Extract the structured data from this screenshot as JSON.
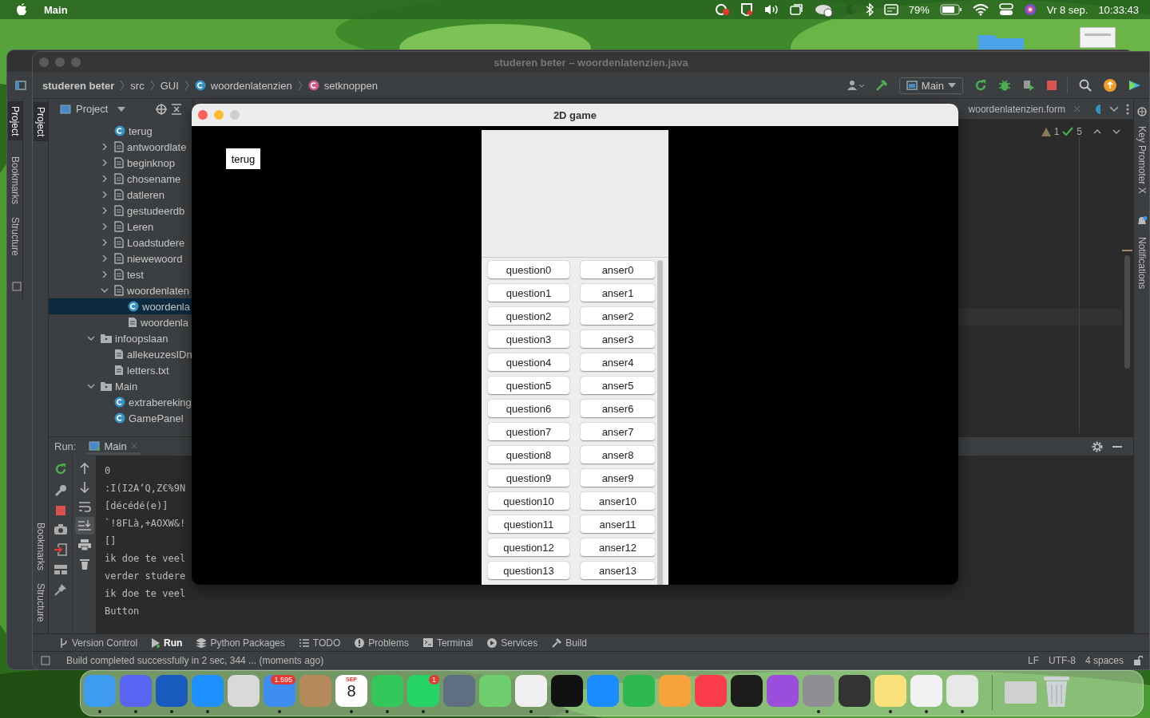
{
  "menu_bar": {
    "app_name": "Main",
    "battery": "79%",
    "date": "Vr 8 sep.",
    "time": "10:33:43"
  },
  "back_window": {
    "stripe_top": [
      "Project"
    ],
    "stripe_bottom": [
      "Bookmarks",
      "Structure"
    ]
  },
  "ide": {
    "title": "studeren beter – woordenlatenzien.java",
    "breadcrumbs": [
      {
        "label": "studeren beter",
        "kind": "project"
      },
      {
        "label": "src",
        "kind": "folder"
      },
      {
        "label": "GUI",
        "kind": "folder"
      },
      {
        "label": "woordenlatenzien",
        "kind": "class"
      },
      {
        "label": "setknoppen",
        "kind": "method"
      }
    ],
    "run_config": "Main",
    "stripe_top": [
      "Project"
    ],
    "stripe_bottom": [
      "Bookmarks",
      "Structure"
    ],
    "project_panel": {
      "title": "Project",
      "tree": [
        {
          "children": [
            {
              "label": "terug",
              "kind": "class",
              "selected": false
            },
            {
              "label": "antwoordlate",
              "kind": "form",
              "expanded": false,
              "selected": false
            },
            {
              "label": "beginknop",
              "kind": "form",
              "expanded": false,
              "selected": false
            },
            {
              "label": "chosename",
              "kind": "form",
              "expanded": false,
              "selected": false
            },
            {
              "label": "datleren",
              "kind": "form",
              "expanded": false,
              "selected": false
            },
            {
              "label": "gestudeerdb",
              "kind": "form",
              "expanded": false,
              "selected": false
            },
            {
              "label": "Leren",
              "kind": "form",
              "expanded": false,
              "selected": false
            },
            {
              "label": "Loadstudere",
              "kind": "form",
              "expanded": false,
              "selected": false
            },
            {
              "label": "niewewoord",
              "kind": "form",
              "expanded": false,
              "selected": false
            },
            {
              "label": "test",
              "kind": "form",
              "expanded": false,
              "selected": false
            },
            {
              "label": "woordenlaten",
              "kind": "form",
              "expanded": true,
              "selected": false,
              "children": [
                {
                  "label": "woordenla",
                  "kind": "class",
                  "selected": true
                },
                {
                  "label": "woordenla",
                  "kind": "file",
                  "selected": false
                }
              ]
            }
          ]
        },
        {
          "label": "infoopslaan",
          "kind": "folder",
          "expanded": true,
          "selected": false,
          "children": [
            {
              "label": "allekeuzesIDn",
              "kind": "file",
              "selected": false
            },
            {
              "label": "letters.txt",
              "kind": "file",
              "selected": false
            }
          ]
        },
        {
          "label": "Main",
          "kind": "folder",
          "expanded": true,
          "selected": false,
          "children": [
            {
              "label": "extrabereking",
              "kind": "class",
              "selected": false
            },
            {
              "label": "GamePanel",
              "kind": "class",
              "selected": false
            }
          ]
        }
      ]
    },
    "editor": {
      "tab": "woordenlatenzien.form",
      "warnings": "1",
      "checks": "5"
    },
    "right_stripe": [
      "Key Promoter X",
      "Notifications"
    ],
    "run_panel": {
      "label": "Run:",
      "tab": "Main",
      "console": [
        "0",
        ":I(I2A‘Q,Z€%9N",
        "[décédé(e)]",
        "`!8FLà,+AOXW&!",
        "[]",
        "ik doe te veel",
        "verder studere",
        "ik doe te veel",
        "Button"
      ]
    },
    "tool_tabs": [
      {
        "label": "Version Control",
        "kind": "vcs",
        "selected": false
      },
      {
        "label": "Run",
        "kind": "run",
        "selected": true
      },
      {
        "label": "Python Packages",
        "kind": "packages",
        "selected": false
      },
      {
        "label": "TODO",
        "kind": "todo",
        "selected": false
      },
      {
        "label": "Problems",
        "kind": "problems",
        "selected": false
      },
      {
        "label": "Terminal",
        "kind": "terminal",
        "selected": false
      },
      {
        "label": "Services",
        "kind": "services",
        "selected": false
      },
      {
        "label": "Build",
        "kind": "build",
        "selected": false
      }
    ],
    "status_bar": {
      "message": "Build completed successfully in 2 sec, 344 ... (moments ago)",
      "line_ending": "LF",
      "encoding": "UTF-8",
      "indent": "4 spaces"
    }
  },
  "game_window": {
    "title": "2D game",
    "back_button": "terug",
    "rows": [
      {
        "question": "question0",
        "answer": "anser0"
      },
      {
        "question": "question1",
        "answer": "anser1"
      },
      {
        "question": "question2",
        "answer": "anser2"
      },
      {
        "question": "question3",
        "answer": "anser3"
      },
      {
        "question": "question4",
        "answer": "anser4"
      },
      {
        "question": "question5",
        "answer": "anser5"
      },
      {
        "question": "question6",
        "answer": "anser6"
      },
      {
        "question": "question7",
        "answer": "anser7"
      },
      {
        "question": "question8",
        "answer": "anser8"
      },
      {
        "question": "question9",
        "answer": "anser9"
      },
      {
        "question": "question10",
        "answer": "anser10"
      },
      {
        "question": "question11",
        "answer": "anser11"
      },
      {
        "question": "question12",
        "answer": "anser12"
      },
      {
        "question": "question13",
        "answer": "anser13"
      }
    ]
  },
  "dock": {
    "apps": [
      {
        "kind": "app",
        "color": "#3e9bf2",
        "running": true
      },
      {
        "kind": "app",
        "color": "#5865f2",
        "running": true
      },
      {
        "kind": "app",
        "color": "#185abd",
        "running": true
      },
      {
        "kind": "app",
        "color": "#1e90ff",
        "running": true
      },
      {
        "kind": "app",
        "color": "#d9d9d9",
        "running": false
      },
      {
        "kind": "app",
        "color": "#3d8ef0",
        "running": true,
        "badge": "1.595"
      },
      {
        "kind": "app",
        "color": "#b58a5a",
        "running": false
      },
      {
        "kind": "calendar",
        "color": "#ffffff",
        "running": true,
        "month": "SEP",
        "day": "8"
      },
      {
        "kind": "app",
        "color": "#34c759",
        "running": true
      },
      {
        "kind": "app",
        "color": "#25d366",
        "running": true,
        "badge": "1"
      },
      {
        "kind": "app",
        "color": "#5d6f80",
        "running": false
      },
      {
        "kind": "app",
        "color": "#6fcf6f",
        "running": false
      },
      {
        "kind": "app",
        "color": "#f0f0f0",
        "running": true
      },
      {
        "kind": "app",
        "color": "#111111",
        "running": true
      },
      {
        "kind": "app",
        "color": "#1a8cff",
        "running": false
      },
      {
        "kind": "app",
        "color": "#2fb84f",
        "running": false
      },
      {
        "kind": "app",
        "color": "#f7a23b",
        "running": false
      },
      {
        "kind": "app",
        "color": "#fa3c4c",
        "running": false
      },
      {
        "kind": "app",
        "color": "#1c1c1c",
        "running": false
      },
      {
        "kind": "app",
        "color": "#9b4ddb",
        "running": false
      },
      {
        "kind": "app",
        "color": "#8e8e93",
        "running": true
      },
      {
        "kind": "app",
        "color": "#333333",
        "running": false
      },
      {
        "kind": "app",
        "color": "#f9e27a",
        "running": true
      },
      {
        "kind": "app",
        "color": "#f2f2f2",
        "running": true
      },
      {
        "kind": "app",
        "color": "#e8e8e8",
        "running": true
      },
      {
        "kind": "window",
        "color": "#d0d0d0",
        "running": false
      },
      {
        "kind": "trash",
        "color": "#cfd3d6",
        "running": false
      }
    ]
  }
}
